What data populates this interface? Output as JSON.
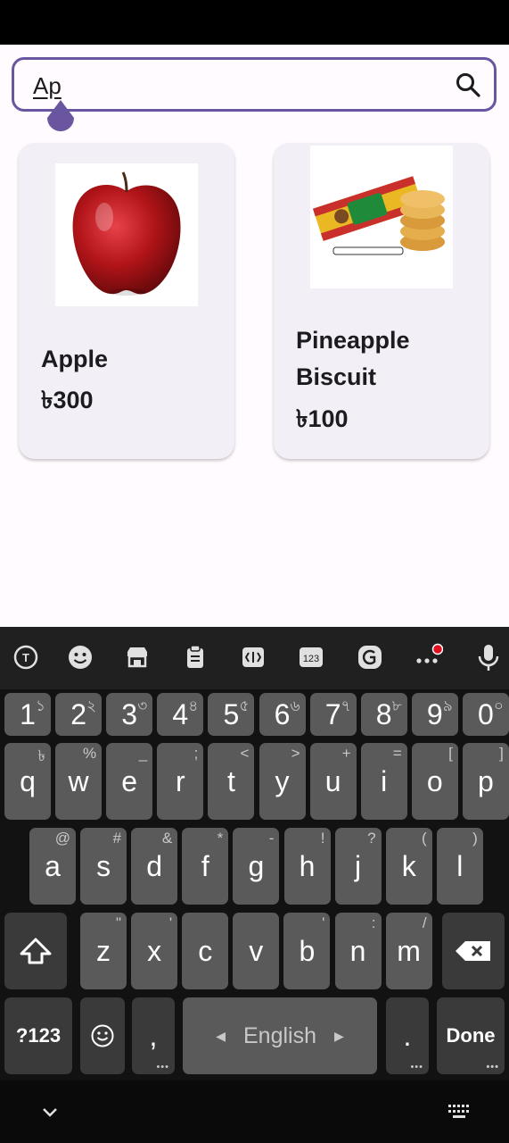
{
  "search": {
    "value": "Ap"
  },
  "products": [
    {
      "name": "Apple",
      "price": "৳300"
    },
    {
      "name": "Pineapple Biscuit",
      "price": "৳100"
    }
  ],
  "keyboard": {
    "toolbar_icons": [
      "translate-icon",
      "emoji-icon",
      "store-icon",
      "clipboard-icon",
      "text-edit-icon",
      "numpad-icon",
      "sticker-icon",
      "more-icon",
      "mic-icon"
    ],
    "numpad_label": "123",
    "number_row": [
      {
        "k": "1",
        "a": "১"
      },
      {
        "k": "2",
        "a": "২"
      },
      {
        "k": "3",
        "a": "৩"
      },
      {
        "k": "4",
        "a": "৪"
      },
      {
        "k": "5",
        "a": "৫"
      },
      {
        "k": "6",
        "a": "৬"
      },
      {
        "k": "7",
        "a": "৭"
      },
      {
        "k": "8",
        "a": "৮"
      },
      {
        "k": "9",
        "a": "৯"
      },
      {
        "k": "0",
        "a": "০"
      }
    ],
    "row1": [
      {
        "k": "q",
        "a": "৳"
      },
      {
        "k": "w",
        "a": "%"
      },
      {
        "k": "e",
        "a": "_"
      },
      {
        "k": "r",
        "a": ";"
      },
      {
        "k": "t",
        "a": "<"
      },
      {
        "k": "y",
        "a": ">"
      },
      {
        "k": "u",
        "a": "+"
      },
      {
        "k": "i",
        "a": "="
      },
      {
        "k": "o",
        "a": "["
      },
      {
        "k": "p",
        "a": "]"
      }
    ],
    "row2": [
      {
        "k": "a",
        "a": "@"
      },
      {
        "k": "s",
        "a": "#"
      },
      {
        "k": "d",
        "a": "&"
      },
      {
        "k": "f",
        "a": "*"
      },
      {
        "k": "g",
        "a": "-"
      },
      {
        "k": "h",
        "a": "!"
      },
      {
        "k": "j",
        "a": "?"
      },
      {
        "k": "k",
        "a": "("
      },
      {
        "k": "l",
        "a": ")"
      }
    ],
    "row3": [
      {
        "k": "z",
        "a": "\""
      },
      {
        "k": "x",
        "a": "'"
      },
      {
        "k": "c",
        "a": ""
      },
      {
        "k": "v",
        "a": ""
      },
      {
        "k": "b",
        "a": "'"
      },
      {
        "k": "n",
        "a": ":"
      },
      {
        "k": "m",
        "a": "/"
      }
    ],
    "symbols_label": "?123",
    "comma": ",",
    "space_label": "English",
    "period": ".",
    "done_label": "Done"
  }
}
